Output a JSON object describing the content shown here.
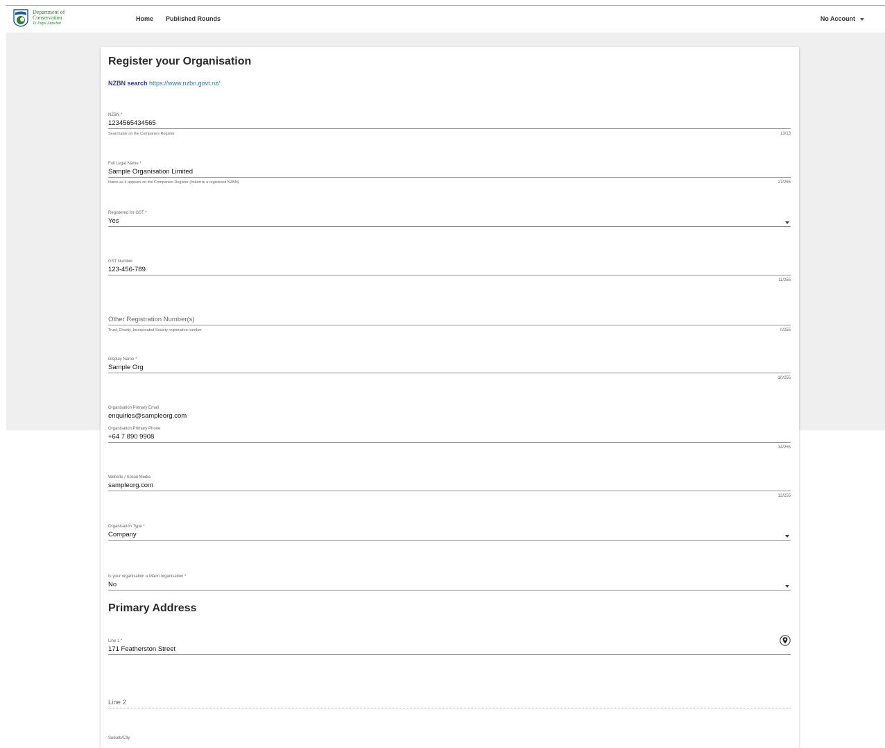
{
  "header": {
    "logo_lines": [
      "Department of",
      "Conservation",
      "Te Papa Atawhai"
    ],
    "nav": [
      "Home",
      "Published Rounds"
    ],
    "account_label": "No Account"
  },
  "form": {
    "title": "Register your Organisation",
    "nzbn_search_label": "NZBN search",
    "nzbn_search_link": "https://www.nzbn.govt.nz/",
    "fields": {
      "nzbn": {
        "label": "NZBN *",
        "value": "1234565434565",
        "hint": "Searchable on the Companies Register",
        "counter": "13/13"
      },
      "legal_name": {
        "label": "Full Legal Name *",
        "value": "Sample Organisation Limited",
        "hint": "Name as it appears on the Companies Register (linked to a registered NZBN)",
        "counter": "27/255"
      },
      "gst_registered": {
        "label": "Registered for GST *",
        "value": "Yes"
      },
      "gst_number": {
        "label": "GST Number",
        "value": "123-456-789",
        "counter": "11/255"
      },
      "other_reg": {
        "placeholder": "Other Registration Number(s)",
        "hint": "Trust, Charity, Incorporated Society registration number",
        "counter": "0/255"
      },
      "display_name": {
        "label": "Display Name *",
        "value": "Sample Org",
        "counter": "10/255"
      },
      "email": {
        "label": "Organisation Primary Email",
        "value": "enquiries@sampleorg.com"
      },
      "phone": {
        "label": "Organisation Primary Phone",
        "value": "+64 7 890 9908",
        "counter": "14/255"
      },
      "website": {
        "label": "Website / Social Media",
        "value": "sampleorg.com",
        "counter": "13/255"
      },
      "org_type": {
        "label": "Organisation Type *",
        "value": "Company"
      },
      "maori_org": {
        "label": "Is your organisation a Māori organisation *",
        "value": "No"
      }
    },
    "address": {
      "title": "Primary Address",
      "line1": {
        "label": "Line 1 *",
        "value": "171 Featherston Street"
      },
      "line2": {
        "placeholder": "Line 2"
      },
      "suburb": {
        "label": "Suburb/City"
      }
    }
  },
  "colors": {
    "accent_blue": "#2d3a8c",
    "link": "#2f7a96",
    "logo_green": "#2e7d32",
    "logo_blue": "#1f5c8a"
  }
}
